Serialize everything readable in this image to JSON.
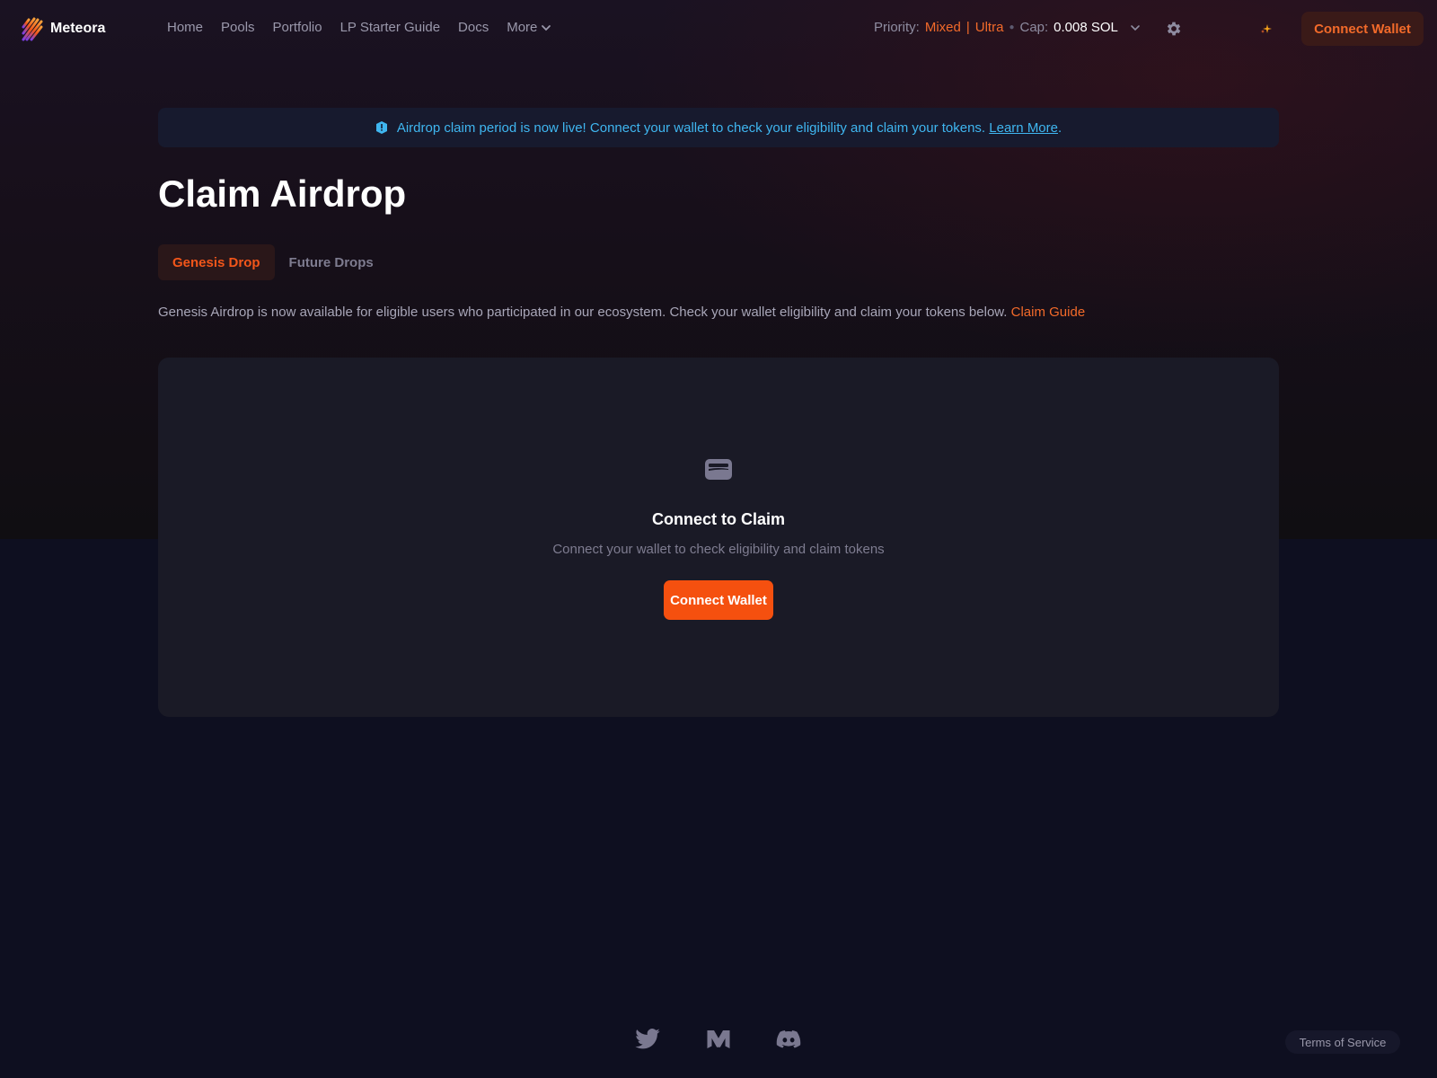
{
  "header": {
    "logo_text": "Meteora",
    "nav": [
      "Home",
      "Pools",
      "Portfolio",
      "LP Starter Guide",
      "Docs"
    ],
    "more_label": "More",
    "priority_label": "Priority:",
    "priority_mode": "Mixed",
    "priority_separator": "|",
    "priority_level": "Ultra",
    "cap_label": "Cap:",
    "cap_value": "0.008 SOL",
    "connect_label": "Connect Wallet"
  },
  "banner": {
    "text": "Airdrop claim period is now live! Connect your wallet to check your eligibility and claim your tokens.",
    "link": "Learn More",
    "suffix": "."
  },
  "page": {
    "title": "Claim Airdrop",
    "tabs": [
      "Genesis Drop",
      "Future Drops"
    ],
    "description": "Genesis Airdrop is now available for eligible users who participated in our ecosystem. Check your wallet eligibility and claim your tokens below.",
    "description_link": "Claim Guide"
  },
  "card": {
    "title": "Connect to Claim",
    "subtitle": "Connect your wallet to check eligibility and claim tokens",
    "button": "Connect Wallet"
  },
  "footer": {
    "icons": [
      "twitter-icon",
      "medium-icon",
      "discord-icon"
    ],
    "terms": "Terms of Service"
  },
  "colors": {
    "accent": "#f5500f",
    "banner_text": "#3fb6f0",
    "background": "#0e0f20"
  }
}
